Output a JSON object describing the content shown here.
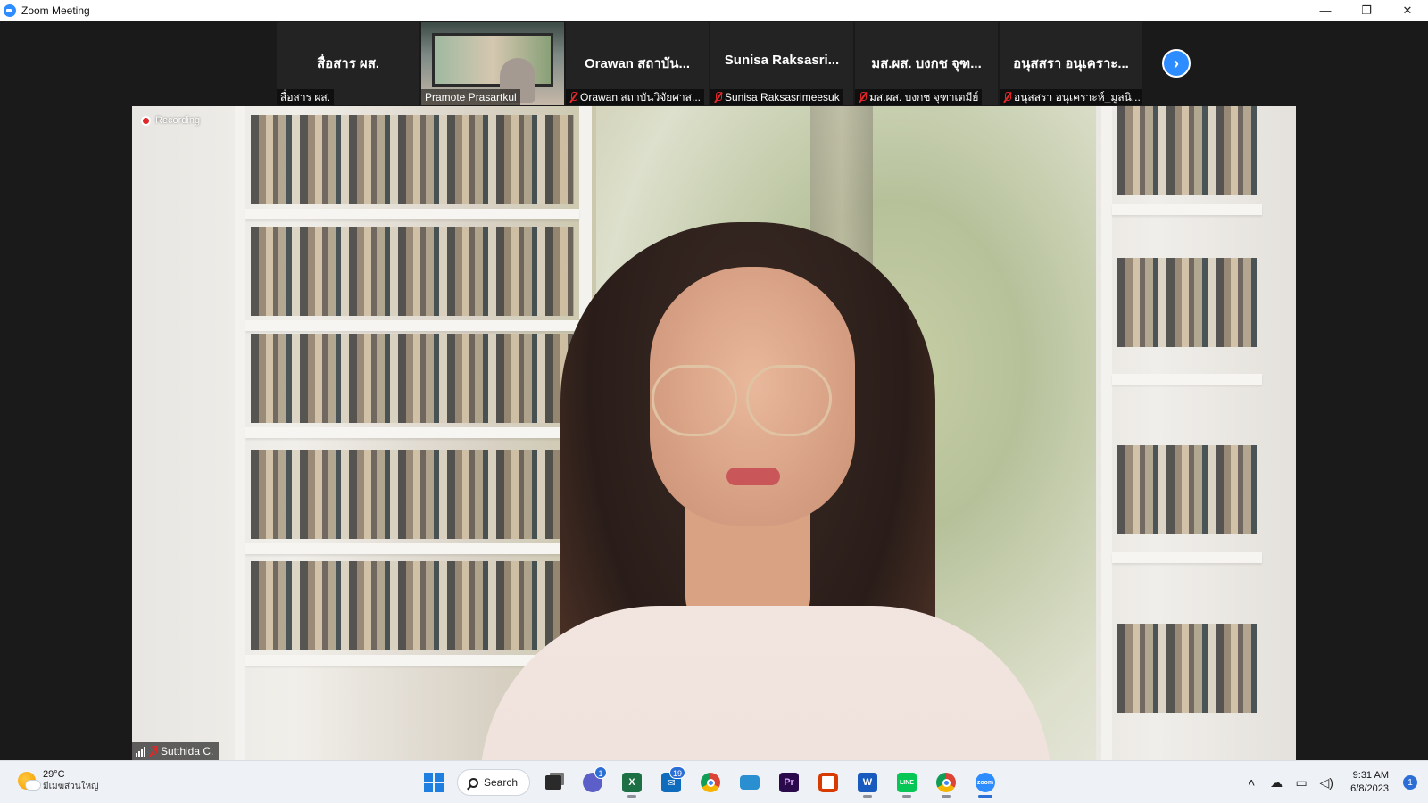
{
  "window": {
    "title": "Zoom Meeting",
    "minimize_glyph": "—",
    "restore_glyph": "❐",
    "close_glyph": "✕"
  },
  "thumbnails": [
    {
      "big_name": "สื่อสาร ผส.",
      "label": "สื่อสาร ผส.",
      "muted": false,
      "video": false
    },
    {
      "big_name": "",
      "label": "Pramote Prasartkul",
      "muted": false,
      "video": true
    },
    {
      "big_name": "Orawan สถาบัน...",
      "label": "Orawan สถาบันวิจัยศาส...",
      "muted": true,
      "video": false
    },
    {
      "big_name": "Sunisa  Raksasri...",
      "label": "Sunisa Raksasrimeesuk",
      "muted": true,
      "video": false
    },
    {
      "big_name": "มส.ผส.  บงกช จุฑ...",
      "label": "มส.ผส.  บงกช จุฑาเตมีย์",
      "muted": true,
      "video": false
    },
    {
      "big_name": "อนุสสรา อนุเคราะ...",
      "label": "อนุสสรา อนุเคราะห์_มูลนิ...",
      "muted": true,
      "video": false
    }
  ],
  "next_page_glyph": "›",
  "main_video": {
    "recording_label": "Recording",
    "speaker_name": "Sutthida C."
  },
  "taskbar": {
    "weather_temp": "29°C",
    "weather_desc": "มีเมฆส่วนใหญ่",
    "search_label": "Search",
    "apps": [
      {
        "name": "start",
        "label": ""
      },
      {
        "name": "search",
        "label": "Search"
      },
      {
        "name": "task-view",
        "label": ""
      },
      {
        "name": "teams-chat",
        "label": "",
        "badge": "1"
      },
      {
        "name": "excel",
        "label": "X"
      },
      {
        "name": "mail",
        "label": "",
        "badge": "19"
      },
      {
        "name": "chrome",
        "label": ""
      },
      {
        "name": "remote-desktop",
        "label": ""
      },
      {
        "name": "premiere",
        "label": "Pr"
      },
      {
        "name": "office",
        "label": ""
      },
      {
        "name": "word",
        "label": "W"
      },
      {
        "name": "line",
        "label": "LINE"
      },
      {
        "name": "chrome-profile",
        "label": ""
      },
      {
        "name": "zoom",
        "label": "zoom"
      }
    ],
    "time": "9:31 AM",
    "date": "6/8/2023",
    "notification_count": "1"
  },
  "colors": {
    "zoom_blue": "#2d8cff",
    "muted_red": "#e02828",
    "taskbar_bg": "#eef1f6"
  }
}
